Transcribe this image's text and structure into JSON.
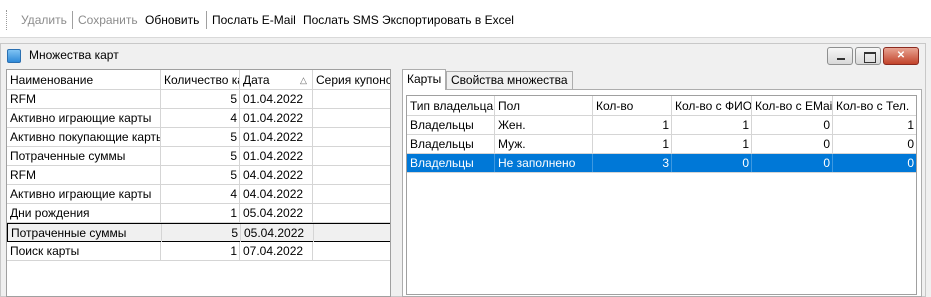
{
  "toolbar": {
    "delete_label": "Удалить",
    "save_label": "Сохранить",
    "refresh_label": "Обновить",
    "email_label": "Послать E-Mail",
    "sms_label": "Послать SMS",
    "excel_label": "Экспортировать в Excel"
  },
  "window": {
    "title": "Множества карт",
    "minimize_glyph": "",
    "maximize_glyph": "",
    "close_glyph": "✕"
  },
  "left_table": {
    "columns": [
      "Наименование",
      "Количество ка",
      "Дата",
      "Серия купоно"
    ],
    "sort_glyph": "△",
    "rows": [
      {
        "name": "RFM",
        "count": "5",
        "date": "01.04.2022",
        "series": ""
      },
      {
        "name": "Активно играющие карты",
        "count": "4",
        "date": "01.04.2022",
        "series": ""
      },
      {
        "name": "Активно покупающие карты",
        "count": "5",
        "date": "01.04.2022",
        "series": ""
      },
      {
        "name": "Потраченные суммы",
        "count": "5",
        "date": "01.04.2022",
        "series": ""
      },
      {
        "name": "RFM",
        "count": "5",
        "date": "04.04.2022",
        "series": ""
      },
      {
        "name": "Активно играющие карты",
        "count": "4",
        "date": "04.04.2022",
        "series": ""
      },
      {
        "name": "Дни рождения",
        "count": "1",
        "date": "05.04.2022",
        "series": ""
      },
      {
        "name": "Потраченные суммы",
        "count": "5",
        "date": "05.04.2022",
        "series": ""
      },
      {
        "name": "Поиск карты",
        "count": "1",
        "date": "07.04.2022",
        "series": ""
      }
    ]
  },
  "tabs": {
    "items": [
      "Карты",
      "Свойства множества"
    ],
    "active": "Карты"
  },
  "right_table": {
    "columns": [
      "Тип владельца",
      "Пол",
      "Кол-во",
      "Кол-во с ФИО",
      "Кол-во с EMail",
      "Кол-во с Тел."
    ],
    "rows": [
      {
        "owner_type": "Владельцы",
        "gender": "Жен.",
        "count": "1",
        "with_fio": "1",
        "with_email": "0",
        "with_phone": "1"
      },
      {
        "owner_type": "Владельцы",
        "gender": "Муж.",
        "count": "1",
        "with_fio": "1",
        "with_email": "0",
        "with_phone": "0"
      },
      {
        "owner_type": "Владельцы",
        "gender": "Не заполнено",
        "count": "3",
        "with_fio": "0",
        "with_email": "0",
        "with_phone": "0"
      }
    ]
  },
  "colors": {
    "selection": "#0078d7",
    "close_button": "#c2432a"
  }
}
